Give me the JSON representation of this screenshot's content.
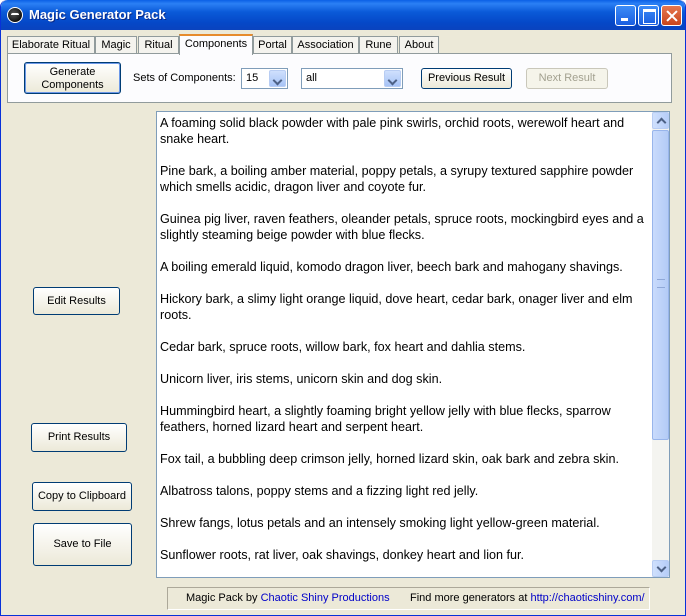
{
  "window": {
    "title": "Magic Generator Pack",
    "icon": "crystal-ball-icon"
  },
  "tabs": [
    {
      "label": "Elaborate Ritual",
      "active": false
    },
    {
      "label": "Magic",
      "active": false
    },
    {
      "label": "Ritual",
      "active": false
    },
    {
      "label": "Components",
      "active": true
    },
    {
      "label": "Portal",
      "active": false
    },
    {
      "label": "Association",
      "active": false
    },
    {
      "label": "Rune",
      "active": false
    },
    {
      "label": "About",
      "active": false
    }
  ],
  "toolbar": {
    "generate_line1": "Generate",
    "generate_line2": "Components",
    "sets_label": "Sets of Components:",
    "sets_value": "15",
    "filter_value": "all",
    "previous_label": "Previous Result",
    "next_label": "Next Result"
  },
  "side_buttons": {
    "edit": "Edit Results",
    "print": "Print Results",
    "copy": "Copy to Clipboard",
    "save": "Save to File"
  },
  "results": [
    "A foaming solid black powder with pale pink swirls, orchid roots, werewolf heart and snake heart.",
    "Pine bark, a boiling amber material, poppy petals, a syrupy textured sapphire powder which smells acidic, dragon liver and coyote fur.",
    "Guinea pig liver, raven feathers, oleander petals, spruce roots, mockingbird eyes and a slightly steaming beige powder with blue flecks.",
    "A boiling emerald liquid, komodo dragon liver, beech bark and mahogany shavings.",
    "Hickory bark, a slimy light orange liquid, dove heart, cedar bark, onager liver and elm roots.",
    "Cedar bark, spruce roots, willow bark, fox heart and dahlia stems.",
    "Unicorn liver, iris stems, unicorn skin and dog skin.",
    "Hummingbird heart, a slightly foaming bright yellow jelly with blue flecks, sparrow feathers, horned lizard heart and serpent heart.",
    "Fox tail, a bubbling deep crimson jelly, horned lizard skin, oak bark and zebra skin.",
    "Albatross talons, poppy stems and a fizzing light red jelly.",
    "Shrew fangs, lotus petals and an intensely smoking light yellow-green material.",
    "Sunflower roots, rat liver, oak shavings, donkey heart and lion fur."
  ],
  "footer": {
    "credit_prefix": "Magic Pack by",
    "credit_link": "Chaotic Shiny Productions",
    "more_prefix": "Find more generators at",
    "more_link": "http://chaoticshiny.com/"
  },
  "colors": {
    "titlebar": "#0a5ad8",
    "active_tab_accent": "#e68b2c",
    "link": "#0000c8",
    "window_bg": "#ece9d8"
  }
}
